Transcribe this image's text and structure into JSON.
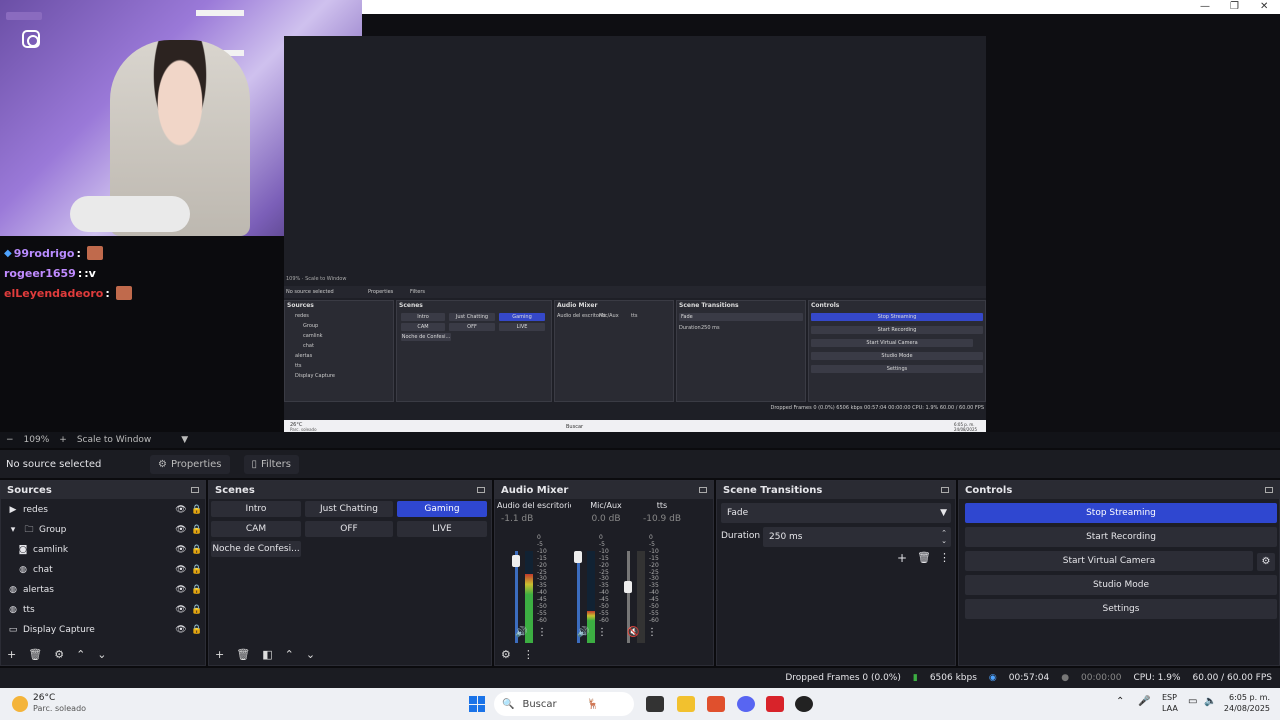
{
  "chat": [
    {
      "user": "99rodrigo",
      "sep": ":",
      "msg": "",
      "color": "#b98cff",
      "badge": true,
      "emote": true
    },
    {
      "user": "rogeer1659",
      "sep": ":",
      "msg": ":v",
      "color": "#c08bff",
      "badge": false,
      "emote": false
    },
    {
      "user": "elLeyendadeoro",
      "sep": ":",
      "msg": "",
      "color": "#e03c3c",
      "badge": false,
      "emote": true
    }
  ],
  "zoom": {
    "minus": "−",
    "value": "109%",
    "plus": "+",
    "mode": "Scale to Window"
  },
  "source_bar": {
    "status": "No source selected",
    "properties": "Properties",
    "filters": "Filters"
  },
  "sources": {
    "title": "Sources",
    "items": [
      {
        "label": "redes",
        "icon": "play-icon"
      },
      {
        "label": "Group",
        "icon": "folder-icon"
      },
      {
        "label": "camlink",
        "icon": "camera-icon"
      },
      {
        "label": "chat",
        "icon": "globe-icon"
      },
      {
        "label": "alertas",
        "icon": "globe-icon"
      },
      {
        "label": "tts",
        "icon": "globe-icon"
      },
      {
        "label": "Display Capture",
        "icon": "monitor-icon"
      }
    ]
  },
  "scenes": {
    "title": "Scenes",
    "items": [
      {
        "label": "Intro"
      },
      {
        "label": "Just Chatting"
      },
      {
        "label": "Gaming"
      },
      {
        "label": "CAM"
      },
      {
        "label": "OFF"
      },
      {
        "label": "LIVE"
      },
      {
        "label": "Noche de Confesi..."
      }
    ],
    "active": "Gaming"
  },
  "mixer": {
    "title": "Audio Mixer",
    "channels": [
      {
        "name": "Audio del escritorio",
        "db": "-1.1 dB",
        "level": 0.75
      },
      {
        "name": "Mic/Aux",
        "db": "0.0 dB",
        "level": 0.35
      },
      {
        "name": "tts",
        "db": "-10.9 dB",
        "level": 0
      }
    ],
    "scale": [
      "0",
      "-5",
      "-10",
      "-15",
      "-20",
      "-25",
      "-30",
      "-35",
      "-40",
      "-45",
      "-50",
      "-55",
      "-60"
    ]
  },
  "transitions": {
    "title": "Scene Transitions",
    "selected": "Fade",
    "duration_label": "Duration",
    "duration": "250 ms"
  },
  "controls": {
    "title": "Controls",
    "stop_streaming": "Stop Streaming",
    "start_recording": "Start Recording",
    "start_virtual_camera": "Start Virtual Camera",
    "studio_mode": "Studio Mode",
    "settings": "Settings"
  },
  "status": {
    "dropped": "Dropped Frames 0 (0.0%)",
    "bitrate": "6506 kbps",
    "stream_time": "00:57:04",
    "rec_time": "00:00:00",
    "cpu": "CPU: 1.9%",
    "fps": "60.00 / 60.00 FPS"
  },
  "taskbar": {
    "weather_temp": "26°C",
    "weather_desc": "Parc. soleado",
    "search": "Buscar",
    "lang": "ESP",
    "lang2": "LAA",
    "time": "6:05 p. m.",
    "date": "24/08/2025"
  },
  "inner": {
    "sources": "Sources",
    "scenes": "Scenes",
    "mixer": "Audio Mixer",
    "transitions": "Scene Transitions",
    "controls": "Controls",
    "no_source": "No source selected",
    "properties": "Properties",
    "filters": "Filters",
    "zoom": "109%",
    "scale": "Scale to Window",
    "src_items": [
      "redes",
      "Group",
      "camlink",
      "chat",
      "alertas",
      "tts",
      "Display Capture"
    ],
    "scene_items": [
      "Intro",
      "Just Chatting",
      "Gaming",
      "CAM",
      "OFF",
      "LIVE",
      "Noche de Confesi..."
    ],
    "ch": [
      "Audio del escritorio",
      "Mic/Aux",
      "tts"
    ],
    "fade": "Fade",
    "duration": "Duration",
    "dur_val": "250 ms",
    "ctrls": [
      "Stop Streaming",
      "Start Recording",
      "Start Virtual Camera",
      "Studio Mode",
      "Settings"
    ],
    "status": "Dropped Frames 0 (0.0%)   6506 kbps   00:57:04   00:00:00   CPU: 1.9%   60.00 / 60.00 FPS",
    "buscar": "Buscar",
    "temp": "26°C",
    "weather": "Parc. soleado",
    "time": "6:05 p. m.",
    "date": "24/08/2025"
  },
  "colors": {
    "accent": "#2f47d0",
    "panel": "#1d1e25",
    "header": "#2a2b33"
  }
}
